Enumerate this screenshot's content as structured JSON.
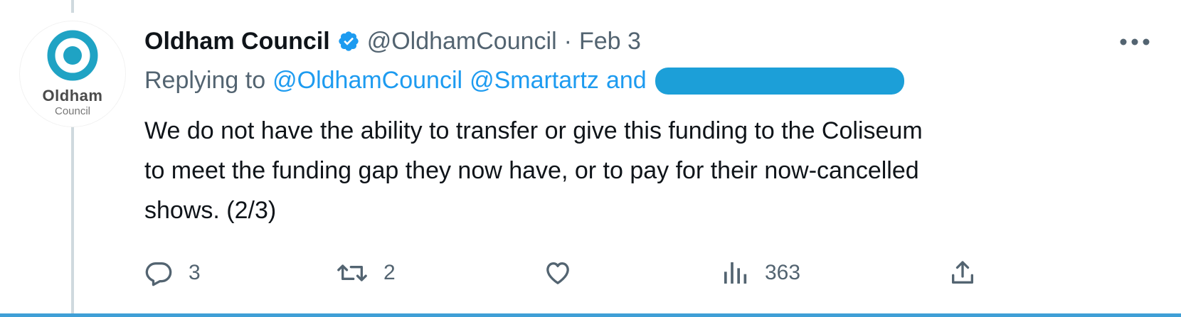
{
  "tweet": {
    "display_name": "Oldham Council",
    "handle": "@OldhamCouncil",
    "separator": "·",
    "date": "Feb 3",
    "verified": true,
    "avatar": {
      "logo_word": "Oldham",
      "logo_sub": "Council",
      "color": "#1fa3c4"
    },
    "replying": {
      "prefix": "Replying to",
      "mentions": [
        "@OldhamCouncil",
        "@Smartartz"
      ],
      "joiner": "and"
    },
    "text_lines": [
      "We do not have the ability to transfer or give this funding to the Coliseum",
      "to meet the funding gap they now have, or to pay for their now-cancelled",
      "shows.  (2/3)"
    ],
    "actions": {
      "reply_count": "3",
      "retweet_count": "2",
      "like_count": "",
      "views_count": "363"
    }
  },
  "colors": {
    "link": "#1d9bf0",
    "secondary_text": "#536471",
    "primary_text": "#0f1419",
    "redaction": "#1c9fd8",
    "bottom_border": "#3f9fd6"
  },
  "icons": {
    "verified": "verified-badge-icon",
    "more": "more-horizontal-icon",
    "reply": "reply-icon",
    "retweet": "retweet-icon",
    "like": "heart-icon",
    "views": "views-chart-icon",
    "share": "share-icon"
  }
}
